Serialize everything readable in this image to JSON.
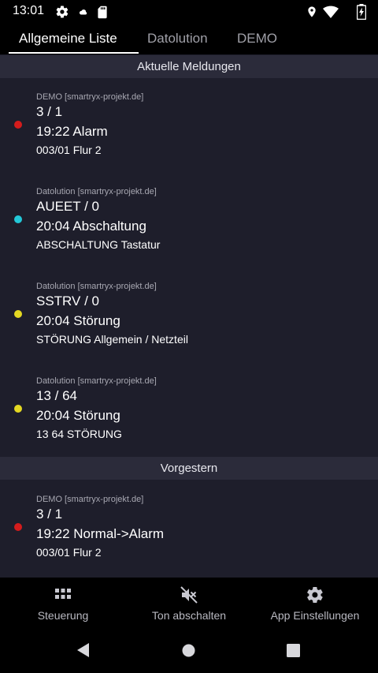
{
  "status_bar": {
    "time": "13:01",
    "left_icons": [
      "gear-icon",
      "cloud-icon",
      "sd-card-icon"
    ],
    "right_icons": [
      "location-icon",
      "wifi-icon",
      "battery-icon"
    ]
  },
  "tabs": [
    {
      "label": "Allgemeine Liste",
      "active": true
    },
    {
      "label": "Datolution",
      "active": false
    },
    {
      "label": "DEMO",
      "active": false
    }
  ],
  "sections": [
    {
      "header": "Aktuelle Meldungen",
      "items": [
        {
          "source": "DEMO [smartryx-projekt.de]",
          "line1": "3 / 1",
          "line2": "19:22 Alarm",
          "line3": "003/01 Flur 2",
          "dot_color": "#d41c1c"
        },
        {
          "source": "Datolution [smartryx-projekt.de]",
          "line1": "AUEET / 0",
          "line2": "20:04 Abschaltung",
          "line3": "ABSCHALTUNG Tastatur",
          "dot_color": "#23c8d8"
        },
        {
          "source": "Datolution [smartryx-projekt.de]",
          "line1": "SSTRV / 0",
          "line2": "20:04 Störung",
          "line3": "STÖRUNG Allgemein / Netzteil",
          "dot_color": "#e4d822"
        },
        {
          "source": "Datolution [smartryx-projekt.de]",
          "line1": "13 / 64",
          "line2": "20:04 Störung",
          "line3": "13 64 STÖRUNG",
          "dot_color": "#e4d822"
        }
      ]
    },
    {
      "header": "Vorgestern",
      "items": [
        {
          "source": "DEMO [smartryx-projekt.de]",
          "line1": "3 / 1",
          "line2": "19:22 Normal->Alarm",
          "line3": "003/01 Flur 2",
          "dot_color": "#d41c1c"
        }
      ]
    }
  ],
  "bottom_nav": [
    {
      "label": "Steuerung",
      "icon": "grid-icon"
    },
    {
      "label": "Ton abschalten",
      "icon": "volume-off-icon"
    },
    {
      "label": "App Einstellungen",
      "icon": "settings-icon"
    }
  ],
  "system_nav": [
    "back-icon",
    "home-icon",
    "recents-icon"
  ]
}
